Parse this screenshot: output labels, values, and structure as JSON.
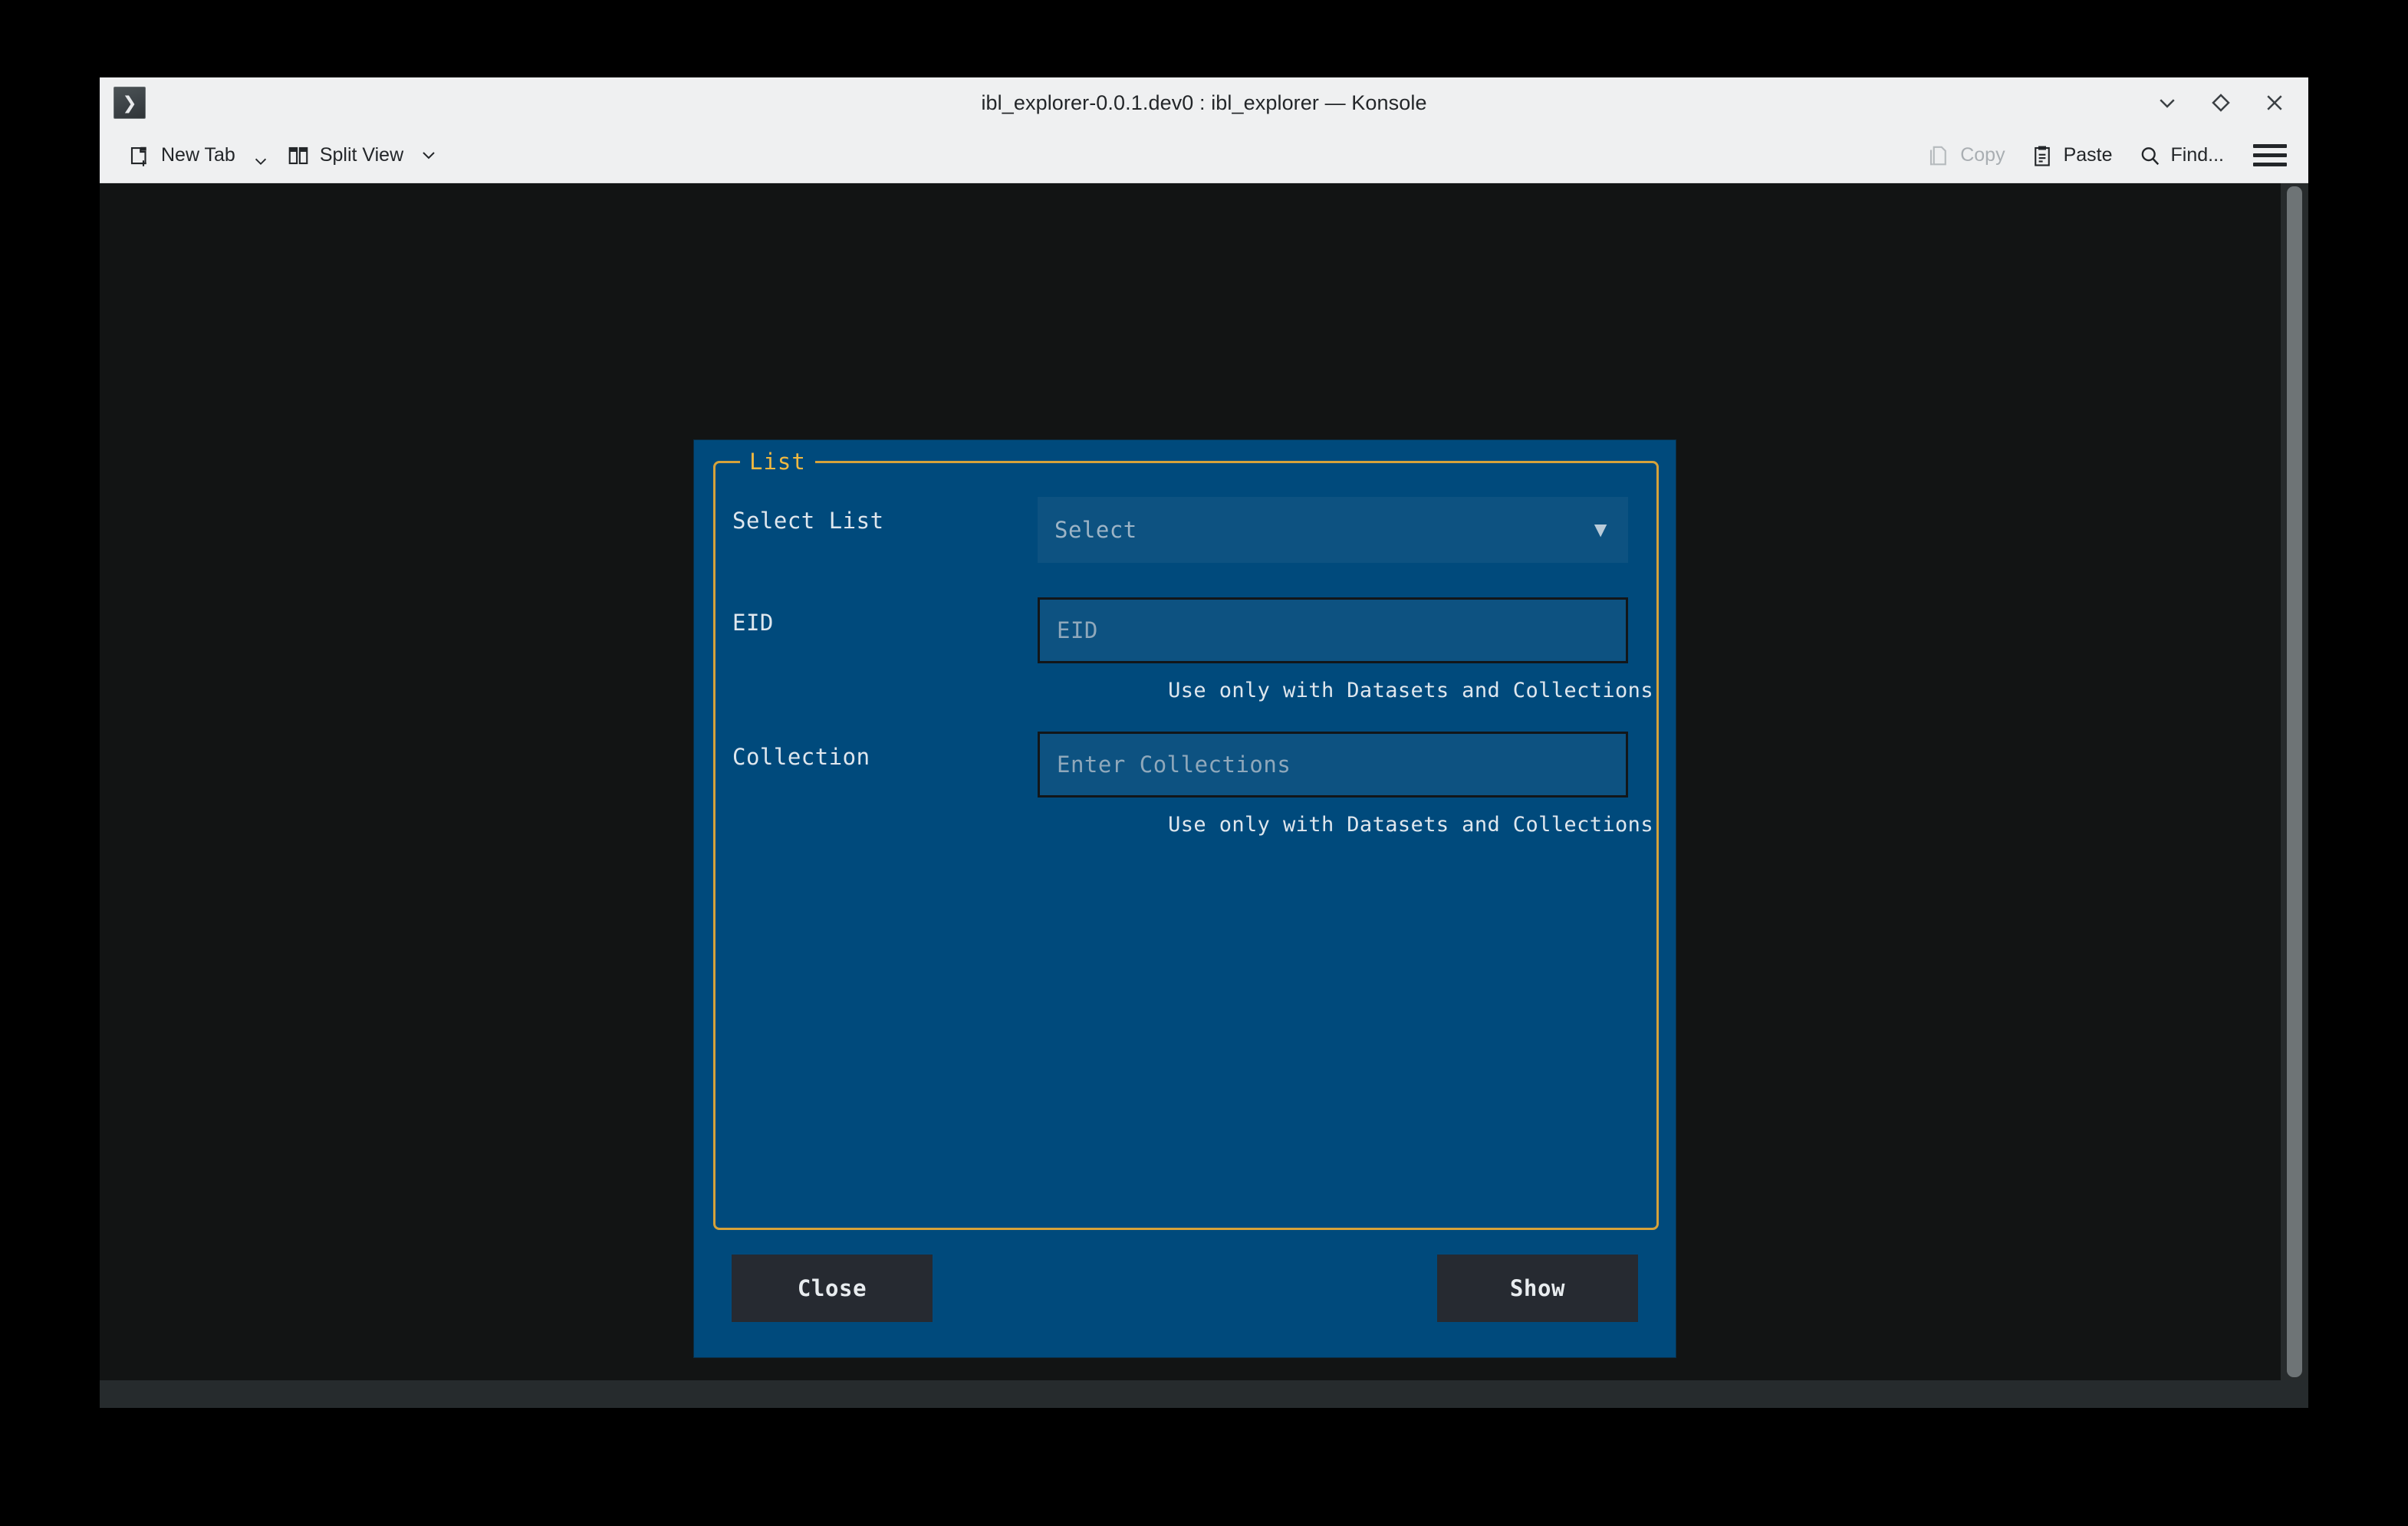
{
  "window": {
    "title": "ibl_explorer-0.0.1.dev0 : ibl_explorer — Konsole",
    "prompt_button_glyph": "❯",
    "controls": [
      {
        "name": "minimize-button",
        "icon": "chevron-down-icon"
      },
      {
        "name": "maximize-button",
        "icon": "diamond-icon"
      },
      {
        "name": "close-button",
        "icon": "close-x-icon"
      }
    ]
  },
  "toolbar": {
    "new_tab_label": "New Tab",
    "split_view_label": "Split View",
    "copy_label": "Copy",
    "paste_label": "Paste",
    "find_label": "Find...",
    "copy_disabled": true,
    "menu_icon": "hamburger-menu-icon"
  },
  "dialog": {
    "groupbox_title": "List",
    "accent_color": "#f0b840",
    "background_color": "#004a7c",
    "fields": [
      {
        "label": "Select List",
        "control": "combobox",
        "placeholder": "Select",
        "value": "",
        "arrow": "▼",
        "hint": ""
      },
      {
        "label": "EID",
        "control": "textinput",
        "placeholder": "EID",
        "value": "",
        "hint": "Use only with Datasets and Collections"
      },
      {
        "label": "Collection",
        "control": "textinput",
        "placeholder": "Enter Collections",
        "value": "",
        "hint": "Use only with Datasets and Collections"
      }
    ],
    "buttons": {
      "close_label": "Close",
      "show_label": "Show"
    }
  }
}
